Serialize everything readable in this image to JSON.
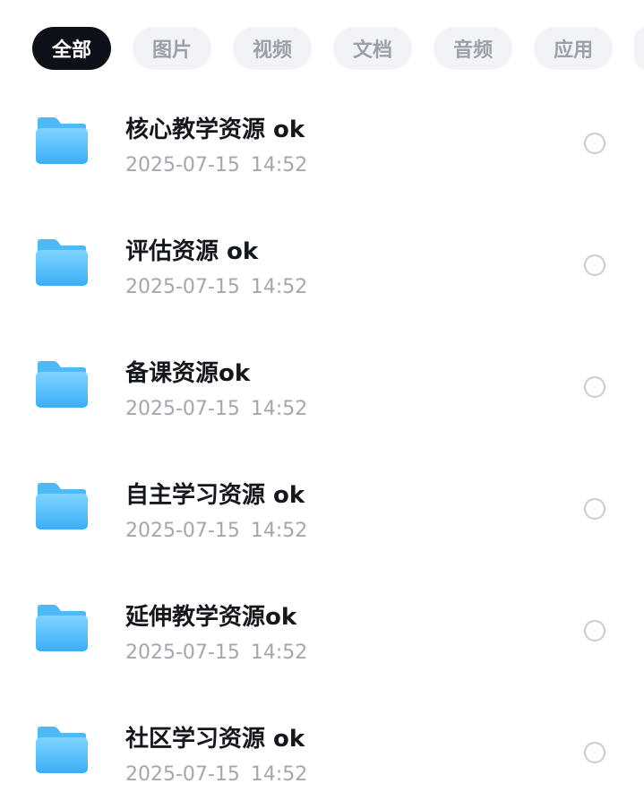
{
  "filters": {
    "all": "全部",
    "images": "图片",
    "videos": "视频",
    "documents": "文档",
    "audio": "音频",
    "apps": "应用"
  },
  "files": [
    {
      "name": "核心教学资源 ok",
      "date": "2025-07-15",
      "time": "14:52"
    },
    {
      "name": "评估资源 ok",
      "date": "2025-07-15",
      "time": "14:52"
    },
    {
      "name": "备课资源ok",
      "date": "2025-07-15",
      "time": "14:52"
    },
    {
      "name": "自主学习资源 ok",
      "date": "2025-07-15",
      "time": "14:52"
    },
    {
      "name": "延伸教学资源ok",
      "date": "2025-07-15",
      "time": "14:52"
    },
    {
      "name": "社区学习资源 ok",
      "date": "2025-07-15",
      "time": "14:52"
    }
  ],
  "icons": {
    "folder": "folder-icon",
    "select": "radio-unchecked-icon"
  },
  "colors": {
    "active_chip": "#0d1016",
    "inactive_chip": "#f1f3f6",
    "folder_top": "#7fd3ff",
    "folder_bottom": "#3aaef7",
    "title_text": "#14171c",
    "meta_text": "#a3a8b0"
  }
}
